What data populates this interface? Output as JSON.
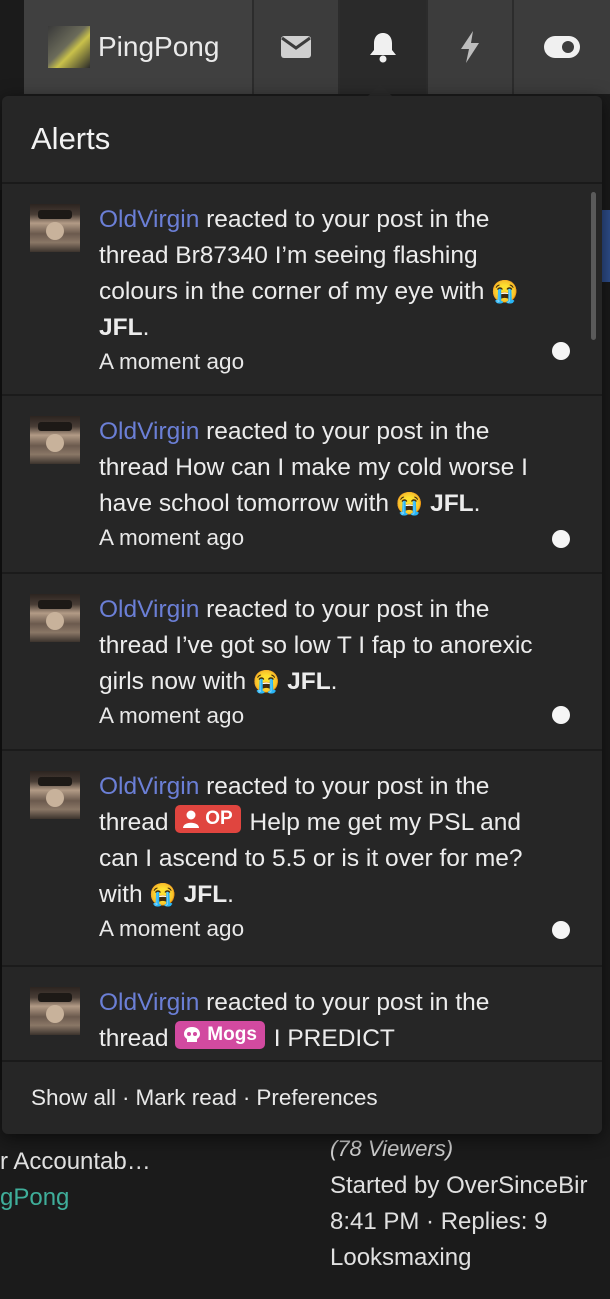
{
  "nav": {
    "username": "PingPong",
    "icons": [
      "envelope-icon",
      "bell-icon",
      "bolt-icon",
      "toggle-icon"
    ]
  },
  "alerts_panel": {
    "title": "Alerts",
    "items": [
      {
        "user": "OldVirgin",
        "action": "reacted to your post in the thread",
        "prefix": "",
        "thread": "Br87340 I’m seeing flashing colours in the corner of my eye",
        "with": "with",
        "emoji": "😭",
        "reaction": "JFL",
        "period": ".",
        "time": "A moment ago",
        "unread": true
      },
      {
        "user": "OldVirgin",
        "action": "reacted to your post in the thread",
        "prefix": "",
        "thread": "How can I make my cold worse I have school tomorrow",
        "with": "with",
        "emoji": "😭",
        "reaction": "JFL",
        "period": ".",
        "time": "A moment ago",
        "unread": true
      },
      {
        "user": "OldVirgin",
        "action": "reacted to your post in the thread",
        "prefix": "",
        "thread": "I’ve got so low T I fap to anorexic girls now",
        "with": "with",
        "emoji": "😭",
        "reaction": "JFL",
        "period": ".",
        "time": "A moment ago",
        "unread": true
      },
      {
        "user": "OldVirgin",
        "action": "reacted to your post in the thread",
        "prefix": "OP",
        "thread": "Help me get my PSL and can I ascend to 5.5 or is it over for me?",
        "with": "with",
        "emoji": "😭",
        "reaction": "JFL",
        "period": ".",
        "time": "A moment ago",
        "unread": true
      },
      {
        "user": "OldVirgin",
        "action": "reacted to your post in the thread",
        "prefix": "Mogs",
        "thread": "I PREDICT",
        "with": "",
        "emoji": "",
        "reaction": "",
        "period": "",
        "time": "",
        "unread": false
      }
    ],
    "footer": {
      "show_all": "Show all",
      "separator": "·",
      "mark_read": "Mark read",
      "preferences": "Preferences"
    }
  },
  "background": {
    "thread_title": "r Accountab…",
    "thread_user": "gPong",
    "viewers": "(78 Viewers)",
    "started_by": "Started by OverSinceBir",
    "meta": "8:41 PM · Replies: 9",
    "forum": "Looksmaxing"
  },
  "colors": {
    "username_link": "#6b7fd6",
    "op_prefix": "#e0453f",
    "mogs_prefix": "#d24aa0",
    "panel_bg": "#262626"
  }
}
